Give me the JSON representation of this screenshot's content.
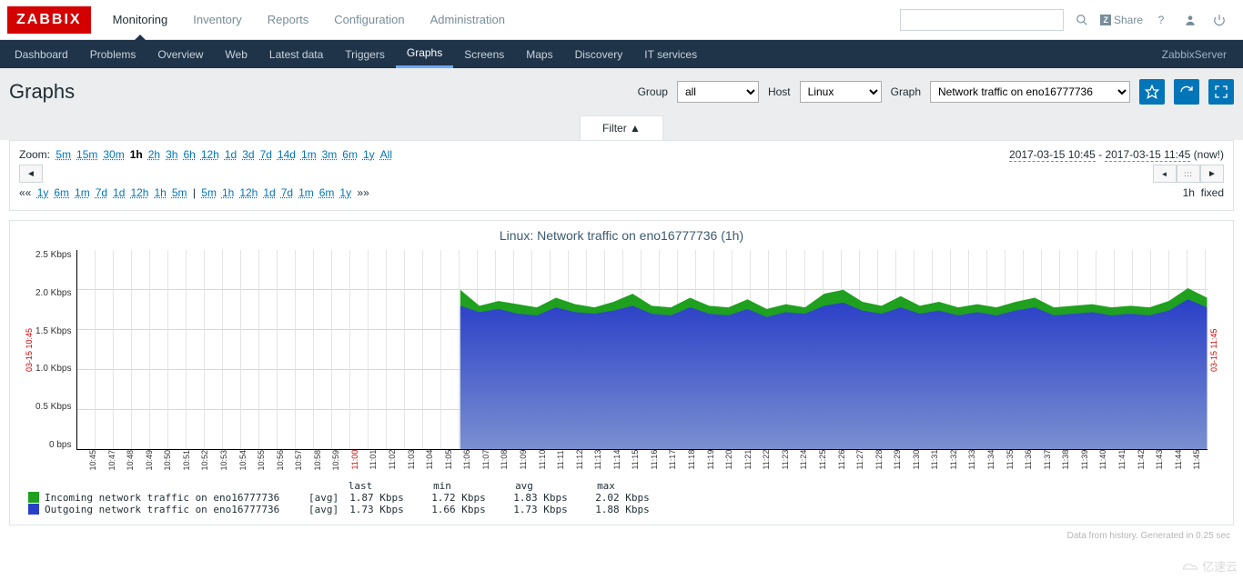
{
  "brand": "ZABBIX",
  "topnav": [
    "Monitoring",
    "Inventory",
    "Reports",
    "Configuration",
    "Administration"
  ],
  "topnav_active": 0,
  "share_label": "Share",
  "subnav": [
    "Dashboard",
    "Problems",
    "Overview",
    "Web",
    "Latest data",
    "Triggers",
    "Graphs",
    "Screens",
    "Maps",
    "Discovery",
    "IT services"
  ],
  "subnav_active": 6,
  "server_label": "ZabbixServer",
  "page_title": "Graphs",
  "filters": {
    "group_label": "Group",
    "group_value": "all",
    "host_label": "Host",
    "host_value": "Linux",
    "graph_label": "Graph",
    "graph_value": "Network traffic on eno16777736"
  },
  "filter_tab": "Filter ▲",
  "zoom": {
    "label": "Zoom:",
    "options": [
      "5m",
      "15m",
      "30m",
      "1h",
      "2h",
      "3h",
      "6h",
      "12h",
      "1d",
      "3d",
      "7d",
      "14d",
      "1m",
      "3m",
      "6m",
      "1y",
      "All"
    ],
    "active": "1h"
  },
  "time_range": {
    "from": "2017-03-15 10:45",
    "to": "2017-03-15 11:45",
    "now": "(now!)"
  },
  "shift_left": [
    "1y",
    "6m",
    "1m",
    "7d",
    "1d",
    "12h",
    "1h",
    "5m"
  ],
  "shift_right": [
    "5m",
    "1h",
    "12h",
    "1d",
    "7d",
    "1m",
    "6m",
    "1y"
  ],
  "period_label": "1h",
  "period_mode": "fixed",
  "chart_title": "Linux: Network traffic on eno16777736 (1h)",
  "chart_data": {
    "type": "area",
    "xlabel": "",
    "ylabel": "",
    "ylim": [
      0,
      2.5
    ],
    "y_unit": "Kbps",
    "y_ticks": [
      "2.5 Kbps",
      "2.0 Kbps",
      "1.5 Kbps",
      "1.0 Kbps",
      "0.5 Kbps",
      "0 bps"
    ],
    "x_ticks": [
      "10:45",
      "10:47",
      "10:48",
      "10:49",
      "10:50",
      "10:51",
      "10:52",
      "10:53",
      "10:54",
      "10:55",
      "10:56",
      "10:57",
      "10:58",
      "10:59",
      "11:00",
      "11:01",
      "11:02",
      "11:03",
      "11:04",
      "11:05",
      "11:06",
      "11:07",
      "11:08",
      "11:09",
      "11:10",
      "11:11",
      "11:12",
      "11:13",
      "11:14",
      "11:15",
      "11:16",
      "11:17",
      "11:18",
      "11:19",
      "11:20",
      "11:21",
      "11:22",
      "11:23",
      "11:24",
      "11:25",
      "11:26",
      "11:27",
      "11:28",
      "11:29",
      "11:30",
      "11:31",
      "11:32",
      "11:33",
      "11:34",
      "11:35",
      "11:36",
      "11:37",
      "11:38",
      "11:39",
      "11:40",
      "11:41",
      "11:42",
      "11:43",
      "11:44",
      "11:45"
    ],
    "x_marks": [
      "11:00"
    ],
    "side_left": "03-15 10:45",
    "side_right": "03-15 11:45",
    "series": [
      {
        "name": "Incoming network traffic on eno16777736",
        "color": "#1fa01f",
        "agg": "[avg]",
        "last": "1.87 Kbps",
        "min": "1.72 Kbps",
        "avg": "1.83 Kbps",
        "max": "2.02 Kbps"
      },
      {
        "name": "Outgoing network traffic on eno16777736",
        "color": "#2a3fc7",
        "agg": "[avg]",
        "last": "1.73 Kbps",
        "min": "1.66 Kbps",
        "avg": "1.73 Kbps",
        "max": "1.88 Kbps"
      }
    ],
    "note": "Data start index approx 20 (~11:06). Before that no data. Incoming stacks on top of outgoing.",
    "x": [
      0,
      1,
      2,
      3,
      4,
      5,
      6,
      7,
      8,
      9,
      10,
      11,
      12,
      13,
      14,
      15,
      16,
      17,
      18,
      19,
      20,
      21,
      22,
      23,
      24,
      25,
      26,
      27,
      28,
      29,
      30,
      31,
      32,
      33,
      34,
      35,
      36,
      37,
      38,
      39,
      40,
      41,
      42,
      43,
      44,
      45,
      46,
      47,
      48,
      49,
      50,
      51,
      52,
      53,
      54,
      55,
      56,
      57,
      58,
      59
    ],
    "incoming": [
      null,
      null,
      null,
      null,
      null,
      null,
      null,
      null,
      null,
      null,
      null,
      null,
      null,
      null,
      null,
      null,
      null,
      null,
      null,
      null,
      2.0,
      1.8,
      1.86,
      1.82,
      1.78,
      1.9,
      1.82,
      1.78,
      1.85,
      1.95,
      1.8,
      1.78,
      1.9,
      1.8,
      1.78,
      1.88,
      1.76,
      1.82,
      1.78,
      1.95,
      2.0,
      1.85,
      1.8,
      1.92,
      1.8,
      1.85,
      1.78,
      1.82,
      1.78,
      1.85,
      1.9,
      1.78,
      1.8,
      1.82,
      1.78,
      1.8,
      1.78,
      1.86,
      2.02,
      1.9
    ],
    "outgoing": [
      null,
      null,
      null,
      null,
      null,
      null,
      null,
      null,
      null,
      null,
      null,
      null,
      null,
      null,
      null,
      null,
      null,
      null,
      null,
      null,
      1.8,
      1.72,
      1.76,
      1.7,
      1.68,
      1.78,
      1.72,
      1.7,
      1.74,
      1.8,
      1.7,
      1.68,
      1.78,
      1.7,
      1.68,
      1.76,
      1.66,
      1.72,
      1.7,
      1.8,
      1.84,
      1.74,
      1.7,
      1.78,
      1.7,
      1.74,
      1.68,
      1.72,
      1.68,
      1.74,
      1.78,
      1.68,
      1.7,
      1.72,
      1.68,
      1.7,
      1.68,
      1.74,
      1.88,
      1.78
    ]
  },
  "legend_columns": [
    "last",
    "min",
    "avg",
    "max"
  ],
  "footer_note": "Data from history. Generated in 0.25 sec",
  "watermark": "亿速云"
}
